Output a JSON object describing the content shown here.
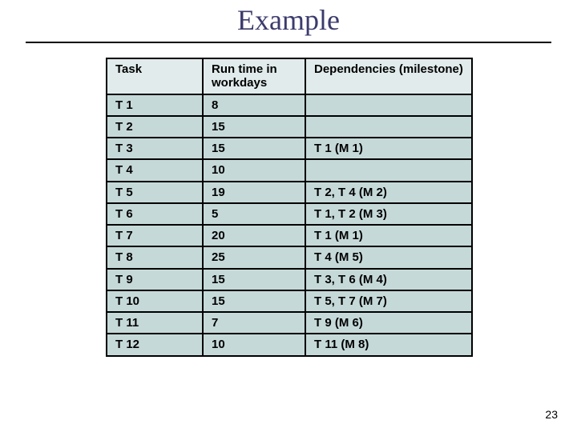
{
  "title": "Example",
  "page_number": "23",
  "headers": {
    "task": "Task",
    "runtime": "Run time in workdays",
    "deps": "Dependencies (milestone)"
  },
  "rows": [
    {
      "task": "T 1",
      "runtime": "8",
      "deps": ""
    },
    {
      "task": "T 2",
      "runtime": "15",
      "deps": ""
    },
    {
      "task": "T 3",
      "runtime": "15",
      "deps": "T 1 (M 1)"
    },
    {
      "task": "T 4",
      "runtime": "10",
      "deps": ""
    },
    {
      "task": "T 5",
      "runtime": "19",
      "deps": "T 2, T 4 (M 2)"
    },
    {
      "task": "T 6",
      "runtime": "5",
      "deps": "T 1, T 2 (M 3)"
    },
    {
      "task": "T 7",
      "runtime": "20",
      "deps": "T 1 (M 1)"
    },
    {
      "task": "T 8",
      "runtime": "25",
      "deps": "T 4 (M 5)"
    },
    {
      "task": "T 9",
      "runtime": "15",
      "deps": "T 3, T 6 (M 4)"
    },
    {
      "task": "T 10",
      "runtime": "15",
      "deps": "T 5, T 7 (M 7)"
    },
    {
      "task": "T 11",
      "runtime": "7",
      "deps": "T 9 (M 6)"
    },
    {
      "task": "T 12",
      "runtime": "10",
      "deps": "T 11 (M 8)"
    }
  ],
  "chart_data": {
    "type": "table",
    "title": "Example",
    "columns": [
      "Task",
      "Run time in workdays",
      "Dependencies (milestone)"
    ],
    "rows": [
      [
        "T 1",
        8,
        ""
      ],
      [
        "T 2",
        15,
        ""
      ],
      [
        "T 3",
        15,
        "T 1 (M 1)"
      ],
      [
        "T 4",
        10,
        ""
      ],
      [
        "T 5",
        19,
        "T 2, T 4 (M 2)"
      ],
      [
        "T 6",
        5,
        "T 1, T 2 (M 3)"
      ],
      [
        "T 7",
        20,
        "T 1 (M 1)"
      ],
      [
        "T 8",
        25,
        "T 4 (M 5)"
      ],
      [
        "T 9",
        15,
        "T 3, T 6 (M 4)"
      ],
      [
        "T 10",
        15,
        "T 5, T 7 (M 7)"
      ],
      [
        "T 11",
        7,
        "T 9 (M 6)"
      ],
      [
        "T 12",
        10,
        "T 11 (M 8)"
      ]
    ]
  }
}
